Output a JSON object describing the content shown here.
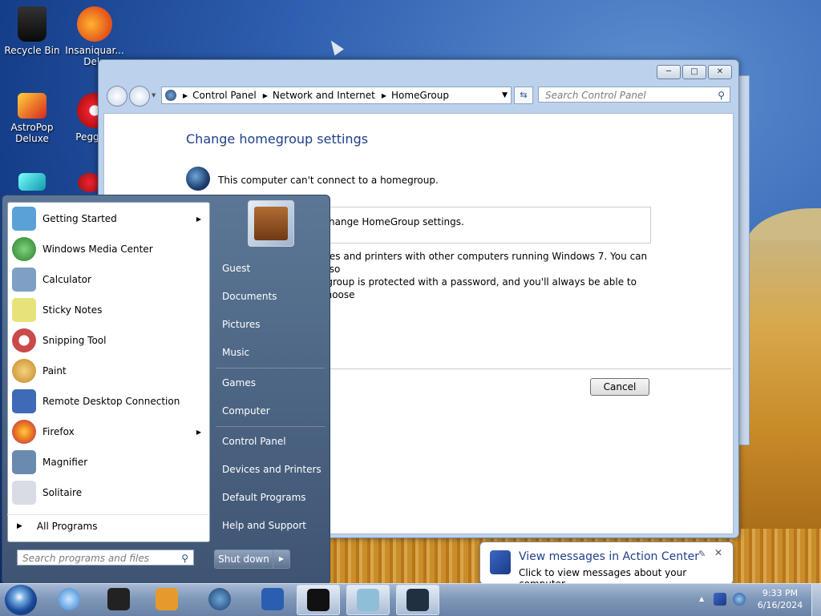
{
  "desktop": {
    "icons": [
      {
        "label": "Recycle Bin"
      },
      {
        "label": "Insaniquar... Delu"
      },
      {
        "label": "AstroPop Deluxe"
      },
      {
        "label": "Peggle I"
      }
    ]
  },
  "window": {
    "caption_buttons": [
      "minimize",
      "maximize",
      "close"
    ],
    "address": {
      "crumbs": [
        "Control Panel",
        "Network and Internet",
        "HomeGroup"
      ]
    },
    "search_placeholder": "Search Control Panel",
    "title": "Change homegroup settings",
    "status": "This computer can't connect to a homegroup.",
    "box_text": "hange HomeGroup settings.",
    "para_line1": "files and printers with other computers running Windows 7. You can also",
    "para_line2": "egroup is protected with a password, and you'll always be able to choose",
    "link": "...",
    "cancel_label": "Cancel"
  },
  "start_menu": {
    "programs": [
      {
        "label": "Getting Started",
        "icon": "getting-started-icon",
        "color": "#5aa1d8",
        "has_arrow": true
      },
      {
        "label": "Windows Media Center",
        "icon": "media-center-icon",
        "color": "#3d9a3d",
        "has_arrow": false
      },
      {
        "label": "Calculator",
        "icon": "calculator-icon",
        "color": "#7fa0c4",
        "has_arrow": false
      },
      {
        "label": "Sticky Notes",
        "icon": "sticky-notes-icon",
        "color": "#e8e27a",
        "has_arrow": false
      },
      {
        "label": "Snipping Tool",
        "icon": "snipping-tool-icon",
        "color": "#c94a4a",
        "has_arrow": false
      },
      {
        "label": "Paint",
        "icon": "paint-icon",
        "color": "#d9a744",
        "has_arrow": false
      },
      {
        "label": "Remote Desktop Connection",
        "icon": "remote-desktop-icon",
        "color": "#3f6ab8",
        "has_arrow": false
      },
      {
        "label": "Firefox",
        "icon": "firefox-icon",
        "color": "#e86a1f",
        "has_arrow": true
      },
      {
        "label": "Magnifier",
        "icon": "magnifier-icon",
        "color": "#6a8ab0",
        "has_arrow": false
      },
      {
        "label": "Solitaire",
        "icon": "solitaire-icon",
        "color": "#d8dce4",
        "has_arrow": false
      }
    ],
    "all_programs": "All Programs",
    "search_placeholder": "Search programs and files",
    "right_items": [
      {
        "label": "Guest"
      },
      {
        "label": "Documents"
      },
      {
        "label": "Pictures"
      },
      {
        "label": "Music"
      },
      {
        "label": "Games"
      },
      {
        "label": "Computer"
      },
      {
        "label": "Control Panel"
      },
      {
        "label": "Devices and Printers"
      },
      {
        "label": "Default Programs"
      },
      {
        "label": "Help and Support"
      }
    ],
    "shutdown": "Shut down"
  },
  "balloon": {
    "title": "View messages in Action Center",
    "text": "Click to view messages about your computer."
  },
  "taskbar": {
    "buttons": [
      {
        "name": "file-explorer-icon",
        "color": "#1b1b1b"
      },
      {
        "name": "internet-explorer-icon",
        "color": "#2f7fd0"
      },
      {
        "name": "black-box-icon",
        "color": "#222222"
      },
      {
        "name": "media-player-icon",
        "color": "#e69a2b"
      },
      {
        "name": "globe-icon",
        "color": "#1a3d6e"
      },
      {
        "name": "powershell-icon",
        "color": "#2a5fb0"
      },
      {
        "name": "command-prompt-icon",
        "color": "#111111"
      },
      {
        "name": "notepad-icon",
        "color": "#8fbfd8"
      },
      {
        "name": "control-panel-icon",
        "color": "#203040"
      }
    ],
    "clock_time": "9:33 PM",
    "clock_date": "6/16/2024"
  }
}
